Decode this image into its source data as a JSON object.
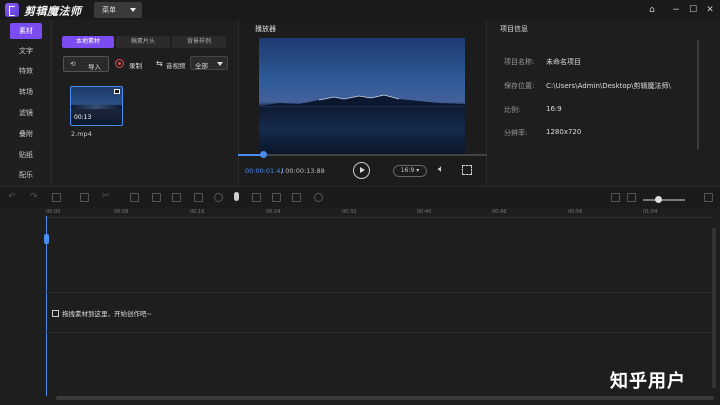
{
  "app": {
    "title": "剪辑魔法师",
    "menu_label": "菜单"
  },
  "window_controls": [
    "home-icon",
    "minimize-icon",
    "maximize-icon",
    "close-icon"
  ],
  "nav": {
    "items": [
      {
        "label": "素材",
        "active": true
      },
      {
        "label": "文字"
      },
      {
        "label": "特效"
      },
      {
        "label": "转场"
      },
      {
        "label": "滤镜"
      },
      {
        "label": "叠附"
      },
      {
        "label": "贴纸"
      },
      {
        "label": "配乐"
      }
    ]
  },
  "media": {
    "tabs": [
      {
        "label": "本地素材",
        "active": true
      },
      {
        "label": "稿素片头"
      },
      {
        "label": "背景样例"
      }
    ],
    "import_label": "导入",
    "record_label": "录制",
    "filter_label": "音视频",
    "filter_value": "全部",
    "items": [
      {
        "filename": "2.mp4",
        "duration": "00:13"
      }
    ]
  },
  "player": {
    "title": "播放器",
    "current_time": "00:00:01.41",
    "total_time": "/ 00:00:13.88",
    "progress": 0.1,
    "ratio": "16:9"
  },
  "info": {
    "title": "项目信息",
    "fields": [
      {
        "key": "项目名称:",
        "value": "未命名项目"
      },
      {
        "key": "保存位置:",
        "value": "C:\\Users\\Admin\\Desktop\\剪辑魔法师\\"
      },
      {
        "key": "比例:",
        "value": "16:9"
      },
      {
        "key": "分辨率:",
        "value": "1280x720"
      }
    ]
  },
  "timeline": {
    "ticks": [
      "00:00",
      "00:08",
      "00:16",
      "00:24",
      "00:32",
      "00:40",
      "00:48",
      "00:56",
      "01:04"
    ],
    "drop_hint": "拖拽素材到这里，开始创作吧~"
  },
  "watermark": "知乎用户",
  "colors": {
    "accent": "#7b4cf0",
    "progress": "#4a8cf0"
  }
}
